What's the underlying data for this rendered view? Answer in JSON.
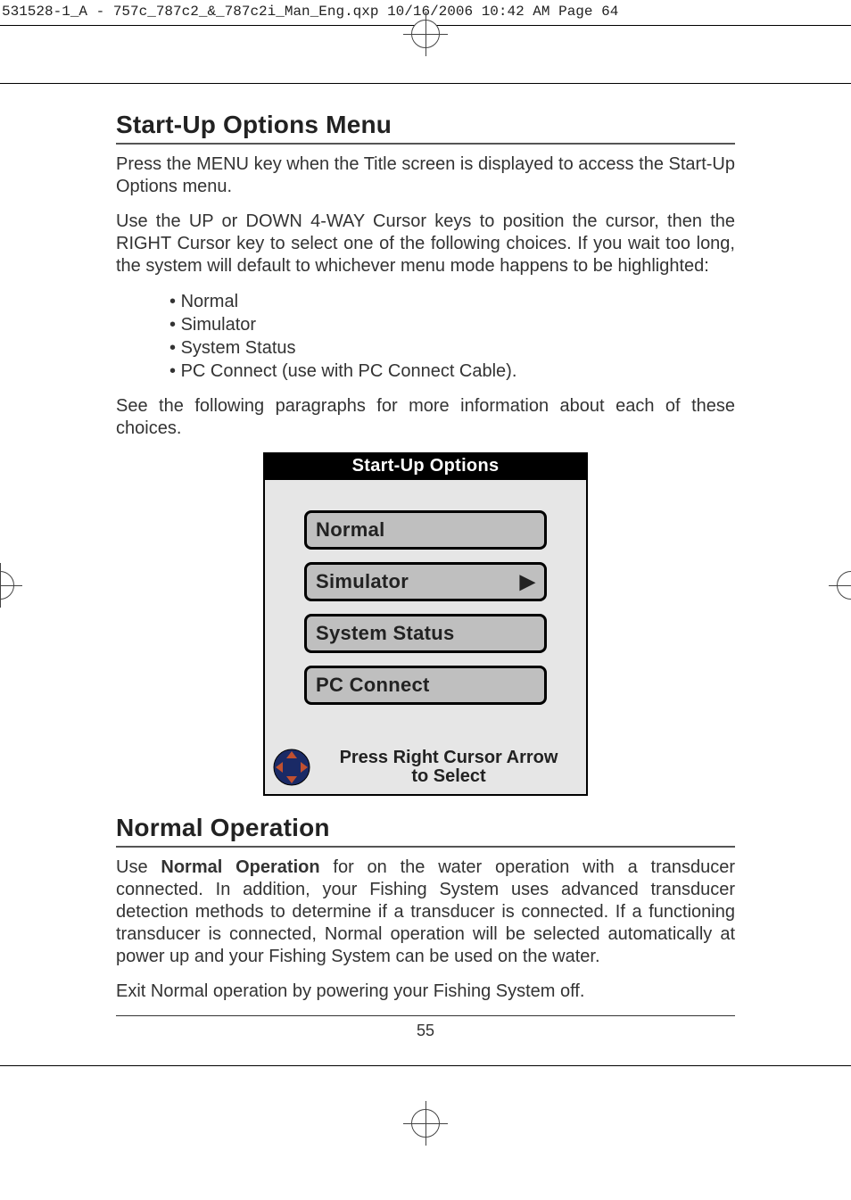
{
  "header": {
    "line": "531528-1_A - 757c_787c2_&_787c2i_Man_Eng.qxp  10/16/2006  10:42 AM  Page 64"
  },
  "section1": {
    "title": "Start-Up Options Menu",
    "p1": "Press the MENU key when the Title screen is displayed to access the Start-Up Options menu.",
    "p2": "Use the UP or DOWN 4-WAY Cursor keys to position the cursor, then the RIGHT Cursor key to select one of the following choices. If you wait too long, the system will default to whichever menu mode happens to be highlighted:",
    "bullets": [
      "Normal",
      "Simulator",
      "System Status",
      "PC Connect (use with PC Connect Cable)."
    ],
    "p3": "See the following paragraphs for more information about each of these choices."
  },
  "startup": {
    "title": "Start-Up Options",
    "items": [
      "Normal",
      "Simulator",
      "System Status",
      "PC Connect"
    ],
    "footer_line1": "Press Right Cursor Arrow",
    "footer_line2": "to  Select"
  },
  "section2": {
    "title": "Normal Operation",
    "p1a": "Use ",
    "p1b": "Normal Operation",
    "p1c": " for on the water operation with a transducer connected. In addition, your Fishing System uses advanced transducer detection methods to determine if a transducer is connected. If a functioning transducer is connected, Normal operation will be selected automatically at power up and your Fishing System can be used on the water.",
    "p2": "Exit Normal operation by powering your Fishing System off."
  },
  "pagenum": "55"
}
